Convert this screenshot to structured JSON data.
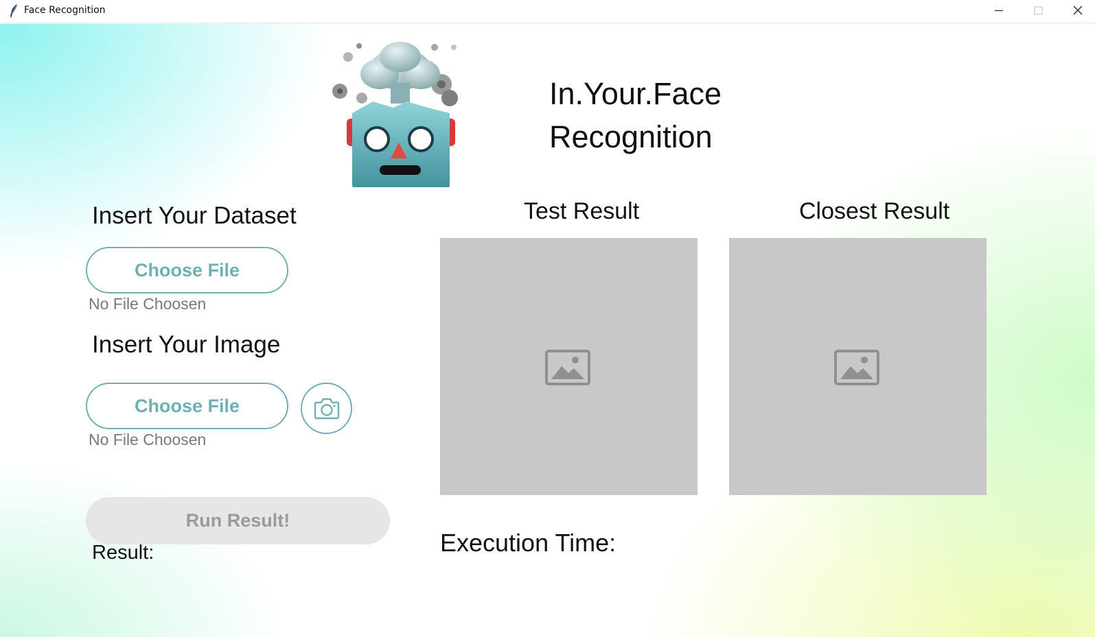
{
  "window": {
    "title": "Face Recognition",
    "controls": [
      "minimize-icon",
      "maximize-icon",
      "close-icon"
    ]
  },
  "header": {
    "logo_icon": "exploding-robot-head-icon",
    "title_line1": "In.Your.Face",
    "title_line2": "Recognition"
  },
  "dataset": {
    "label": "Insert Your Dataset",
    "button_label": "Choose File",
    "file_status": "No File Choosen"
  },
  "image": {
    "label": "Insert Your Image",
    "button_label": "Choose File",
    "file_status": "No File Choosen",
    "camera_icon": "camera-icon"
  },
  "run": {
    "button_label": "Run Result!"
  },
  "result": {
    "label": "Result:"
  },
  "panels": {
    "test_result_title": "Test Result",
    "closest_result_title": "Closest Result",
    "placeholder_icon": "image-placeholder-icon"
  },
  "execution": {
    "label": "Execution Time:"
  },
  "colors": {
    "accent": "#6fb0b2",
    "disabled_button": "#e6e6e6",
    "placeholder_panel": "#c8c8c8",
    "muted_text": "#777777"
  }
}
